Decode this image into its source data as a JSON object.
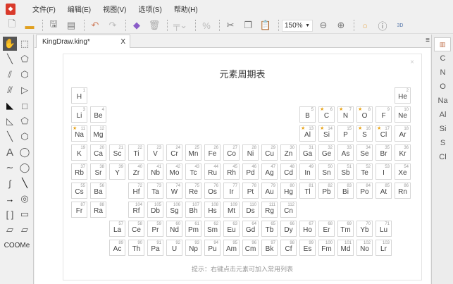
{
  "menu": [
    "文件(F)",
    "编辑(E)",
    "视图(V)",
    "选项(S)",
    "帮助(H)"
  ],
  "toolbar": {
    "zoom_value": "150%"
  },
  "tab": {
    "title": "KingDraw.king*",
    "close": "X"
  },
  "palette": {
    "text_tool": "A",
    "coome_label": "COOMe"
  },
  "dialog": {
    "title": "元素周期表",
    "close": "×",
    "hint": "提示：右键点击元素可加入常用列表"
  },
  "accent": "#e8a317",
  "favorites": [
    "C",
    "N",
    "O",
    "Na",
    "Al",
    "Si",
    "S",
    "Cl"
  ],
  "table": [
    [
      "H:1",
      null,
      null,
      null,
      null,
      null,
      null,
      null,
      null,
      null,
      null,
      null,
      null,
      null,
      null,
      null,
      null,
      "He:2"
    ],
    [
      "Li:3",
      "Be:4",
      null,
      null,
      null,
      null,
      null,
      null,
      null,
      null,
      null,
      null,
      "B:5",
      "C:6:*",
      "N:7:*",
      "O:8:*",
      "F:9",
      "Ne:10"
    ],
    [
      "Na:11:*",
      "Mg:12",
      null,
      null,
      null,
      null,
      null,
      null,
      null,
      null,
      null,
      null,
      "Al:13:*",
      "Si:14:*",
      "P:15",
      "S:16:*",
      "Cl:17:*",
      "Ar:18"
    ],
    [
      "K:19",
      "Ca:20",
      "Sc:21",
      "Ti:22",
      "V:23",
      "Cr:24",
      "Mn:25",
      "Fe:26",
      "Co:27",
      "Ni:28",
      "Cu:29",
      "Zn:30",
      "Ga:31",
      "Ge:32",
      "As:33",
      "Se:34",
      "Br:35",
      "Kr:36"
    ],
    [
      "Rb:37",
      "Sr:38",
      "Y:39",
      "Zr:40",
      "Nb:41",
      "Mo:42",
      "Tc:43",
      "Ru:44",
      "Rh:45",
      "Pd:46",
      "Ag:47",
      "Cd:48",
      "In:49",
      "Sn:50",
      "Sb:51",
      "Te:52",
      "I:53",
      "Xe:54"
    ],
    [
      "Cs:55",
      "Ba:56",
      null,
      "Hf:72",
      "Ta:73",
      "W:74",
      "Re:75",
      "Os:76",
      "Ir:77",
      "Pt:78",
      "Au:79",
      "Hg:80",
      "Tl:81",
      "Pb:82",
      "Bi:83",
      "Po:84",
      "At:85",
      "Rn:86"
    ],
    [
      "Fr:87",
      "Ra:88",
      null,
      "Rf:104",
      "Db:105",
      "Sg:106",
      "Bh:107",
      "Hs:108",
      "Mt:109",
      "Ds:110",
      "Rg:111",
      "Cn:112",
      null,
      null,
      null,
      null,
      null,
      null
    ],
    [
      null,
      null,
      "La:57",
      "Ce:58",
      "Pr:59",
      "Nd:60",
      "Pm:61",
      "Sm:62",
      "Eu:63",
      "Gd:64",
      "Tb:65",
      "Dy:66",
      "Ho:67",
      "Er:68",
      "Tm:69",
      "Yb:70",
      "Lu:71",
      null
    ],
    [
      null,
      null,
      "Ac:89",
      "Th:90",
      "Pa:91",
      "U:92",
      "Np:93",
      "Pu:94",
      "Am:95",
      "Cm:96",
      "Bk:97",
      "Cf:98",
      "Es:99",
      "Fm:100",
      "Md:101",
      "No:102",
      "Lr:103",
      null
    ]
  ]
}
